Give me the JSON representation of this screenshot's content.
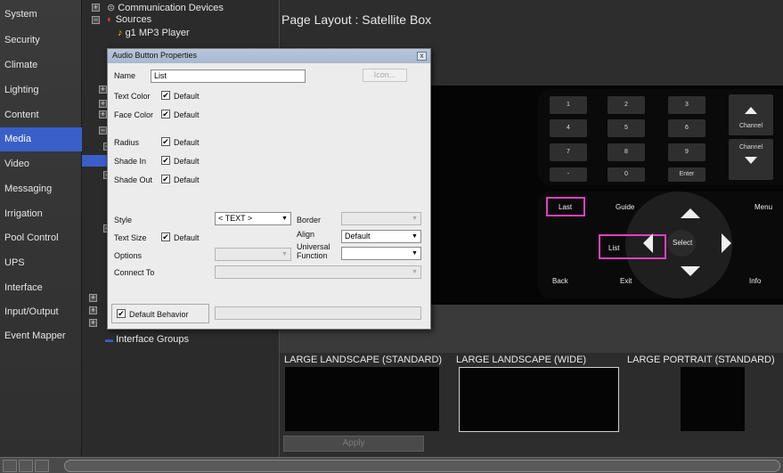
{
  "nav": {
    "items": [
      "System",
      "Security",
      "Climate",
      "Lighting",
      "Content",
      "Media",
      "Video",
      "Messaging",
      "Irrigation",
      "Pool Control",
      "UPS",
      "Interface",
      "Input/Output",
      "Event Mapper"
    ],
    "active": "Media"
  },
  "tree": {
    "communication_devices": "Communication Devices",
    "sources": "Sources",
    "g1_mp3_player": "g1 MP3 Player",
    "interface_groups": "Interface Groups"
  },
  "main": {
    "page_title": "Page Layout : Satellite Box",
    "layouts": [
      "LARGE LANDSCAPE (STANDARD)",
      "LARGE LANDSCAPE (WIDE)",
      "LARGE PORTRAIT (STANDARD)"
    ],
    "apply_label": "Apply"
  },
  "remote": {
    "keys": [
      "1",
      "2",
      "3",
      "4",
      "5",
      "6",
      "7",
      "8",
      "9",
      "-",
      "0",
      "Enter"
    ],
    "channel_up_label": "Channel",
    "channel_down_label": "Channel",
    "last": "Last",
    "guide": "Guide",
    "menu": "Menu",
    "list": "List",
    "select": "Select",
    "back": "Back",
    "exit": "Exit",
    "info": "Info"
  },
  "dialog": {
    "title": "Audio Button Properties",
    "close": "x",
    "name_label": "Name",
    "name_value": "List",
    "icon_button": "Icon...",
    "text_color_label": "Text Color",
    "face_color_label": "Face Color",
    "radius_label": "Radius",
    "shade_in_label": "Shade In",
    "shade_out_label": "Shade Out",
    "default_label": "Default",
    "style_label": "Style",
    "style_value": "< TEXT >",
    "border_label": "Border",
    "text_size_label": "Text Size",
    "align_label": "Align",
    "align_value": "Default",
    "options_label": "Options",
    "universal_function_label_1": "Universal",
    "universal_function_label_2": "Function",
    "connect_to_label": "Connect To",
    "default_behavior_label": "Default Behavior",
    "check_mark": "✔",
    "dropdown_glyph": "▼"
  },
  "colors": {
    "accent": "#3a5fc8",
    "highlight": "#e040c0"
  }
}
